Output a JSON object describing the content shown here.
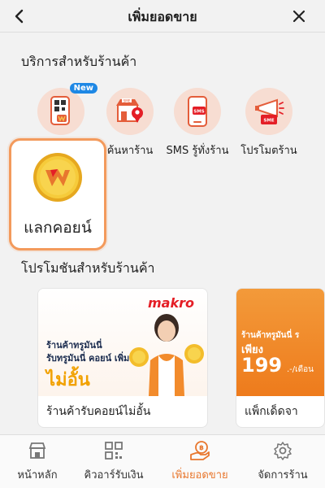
{
  "header": {
    "title": "เพิ่มยอดขาย"
  },
  "services": {
    "title": "บริการสำหรับร้านค้า",
    "new_badge": "New",
    "items": [
      {
        "label": "",
        "icon": "wallet-qr-icon"
      },
      {
        "label": "ค้นหาร้าน",
        "icon": "shop-search-icon"
      },
      {
        "label": "SMS รู้ทั่งร้าน",
        "icon": "sms-phone-icon"
      },
      {
        "label": "โปรโมตร้าน",
        "icon": "megaphone-icon"
      }
    ],
    "highlight_label": "แลกคอยน์",
    "highlight_icon": "coin-icon"
  },
  "promotions": {
    "title": "โปรโมชันสำหรับร้านค้า",
    "cards": [
      {
        "brand": "makro",
        "line1": "ร้านค้าทรูมันนี่",
        "line2": "รับทรูมันนี่ คอยน์ เพิ่ม",
        "big": "ไม่อั้น",
        "caption": "ร้านค้ารับคอยน์ไม่อั้น"
      },
      {
        "line1": "ร้านค้าทรูมันนี่ ร",
        "line2": "เพียง",
        "price": "199",
        "unit": ".-/เดือน",
        "caption": "แพ็กเด็ดจา"
      }
    ]
  },
  "tabbar": {
    "items": [
      {
        "label": "หน้าหลัก",
        "icon": "store-icon"
      },
      {
        "label": "คิวอาร์รับเงิน",
        "icon": "qr-code-icon"
      },
      {
        "label": "เพิ่มยอดขาย",
        "icon": "sales-boost-icon"
      },
      {
        "label": "จัดการร้าน",
        "icon": "gear-icon"
      }
    ],
    "active_index": 2
  },
  "colors": {
    "accent": "#e8772e",
    "highlight_border": "#f39a5c",
    "icon_bg": "#f7ddd2",
    "makro_red": "#e41e26"
  }
}
